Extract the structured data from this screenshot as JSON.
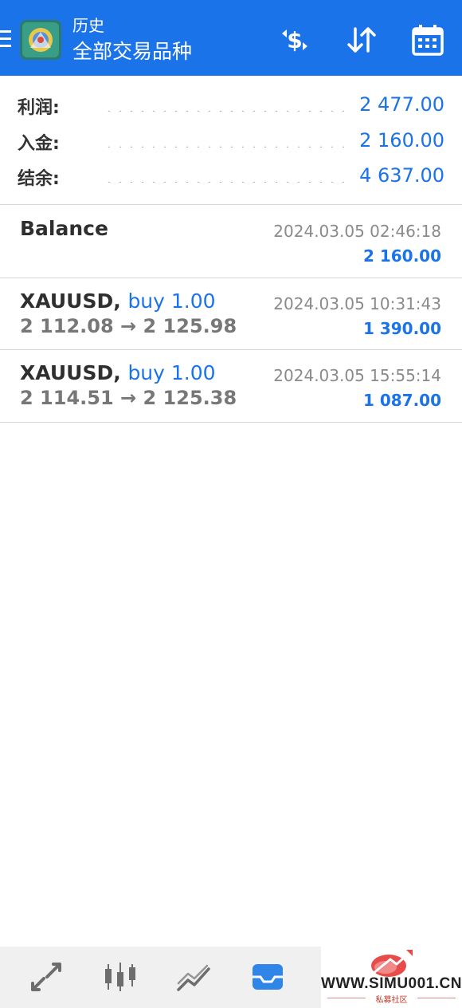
{
  "header": {
    "section_title": "历史",
    "main_title": "全部交易品种"
  },
  "summary": [
    {
      "label": "利润:",
      "value": "2 477.00"
    },
    {
      "label": "入金:",
      "value": "2 160.00"
    },
    {
      "label": "结余:",
      "value": "4 637.00"
    }
  ],
  "deals": [
    {
      "title": "Balance",
      "side": "",
      "prices": "",
      "time": "2024.03.05 02:46:18",
      "amount": "2 160.00"
    },
    {
      "title": "XAUUSD,",
      "side": "buy 1.00",
      "prices": "2 112.08 → 2 125.98",
      "time": "2024.03.05 10:31:43",
      "amount": "1 390.00"
    },
    {
      "title": "XAUUSD,",
      "side": "buy 1.00",
      "prices": "2 114.51 → 2 125.38",
      "time": "2024.03.05 15:55:14",
      "amount": "1 087.00"
    }
  ],
  "icons": {
    "menu": "menu-icon",
    "logo": "metatrader-logo",
    "currency": "currency-exchange-icon",
    "sort": "sort-icon",
    "calendar": "calendar-icon",
    "nav": [
      "quotes-icon",
      "chart-icon",
      "trade-icon",
      "history-icon"
    ]
  },
  "colors": {
    "accent": "#1a73e8",
    "header_bg": "#1a73e8",
    "nav_active": "#2f86e8",
    "nav_inactive": "#6d6d6d"
  },
  "watermark": {
    "site": "WWW.SIMU001.CN",
    "sub": "私募社区"
  }
}
